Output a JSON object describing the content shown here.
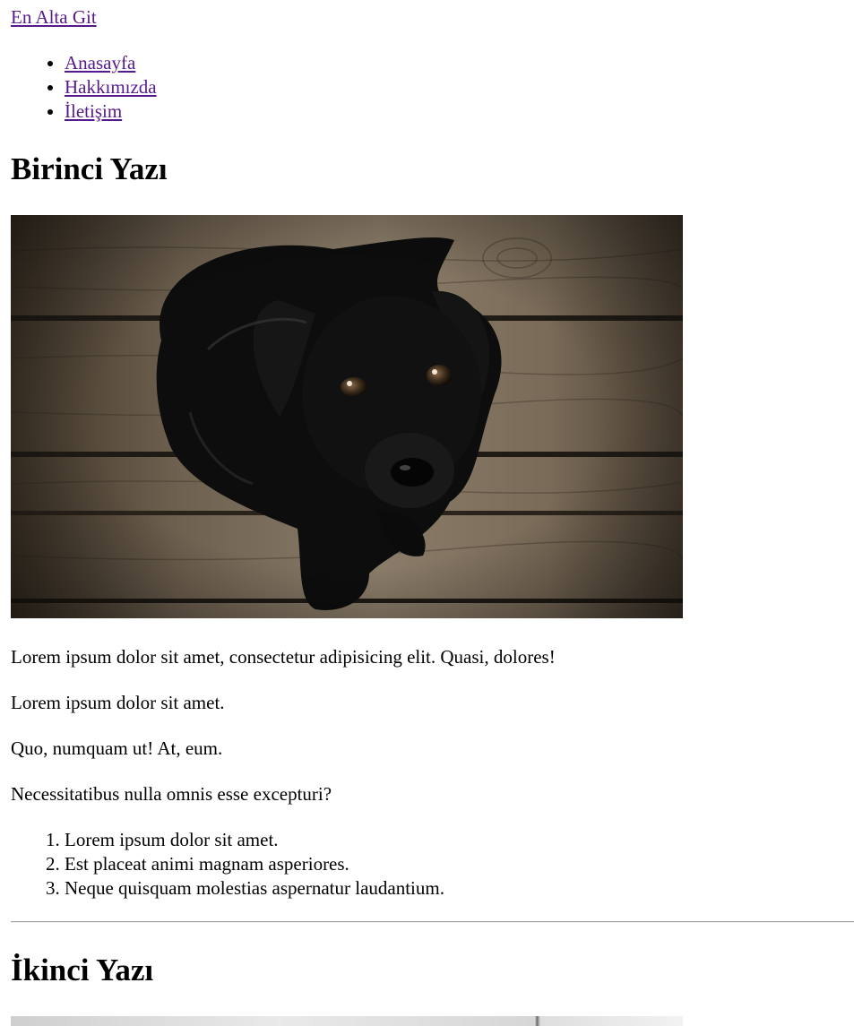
{
  "top_link": "En Alta Git",
  "nav": [
    "Anasayfa",
    "Hakkımızda",
    "İletişim"
  ],
  "posts": [
    {
      "title": "Birinci Yazı",
      "image_icon": "black-puppy-on-wooden-floor-photo",
      "paragraphs": [
        "Lorem ipsum dolor sit amet, consectetur adipisicing elit. Quasi, dolores!",
        "Lorem ipsum dolor sit amet.",
        "Quo, numquam ut! At, eum.",
        "Necessitatibus nulla omnis esse excepturi?"
      ],
      "list": [
        "Lorem ipsum dolor sit amet.",
        "Est placeat animi magnam asperiores.",
        "Neque quisquam molestias aspernatur laudantium."
      ]
    },
    {
      "title": "İkinci Yazı",
      "image_icon": "grayscale-photo"
    }
  ],
  "colors": {
    "link": "#551a8b",
    "text": "#000000",
    "background": "#ffffff",
    "rule": "#a0a0a0"
  }
}
